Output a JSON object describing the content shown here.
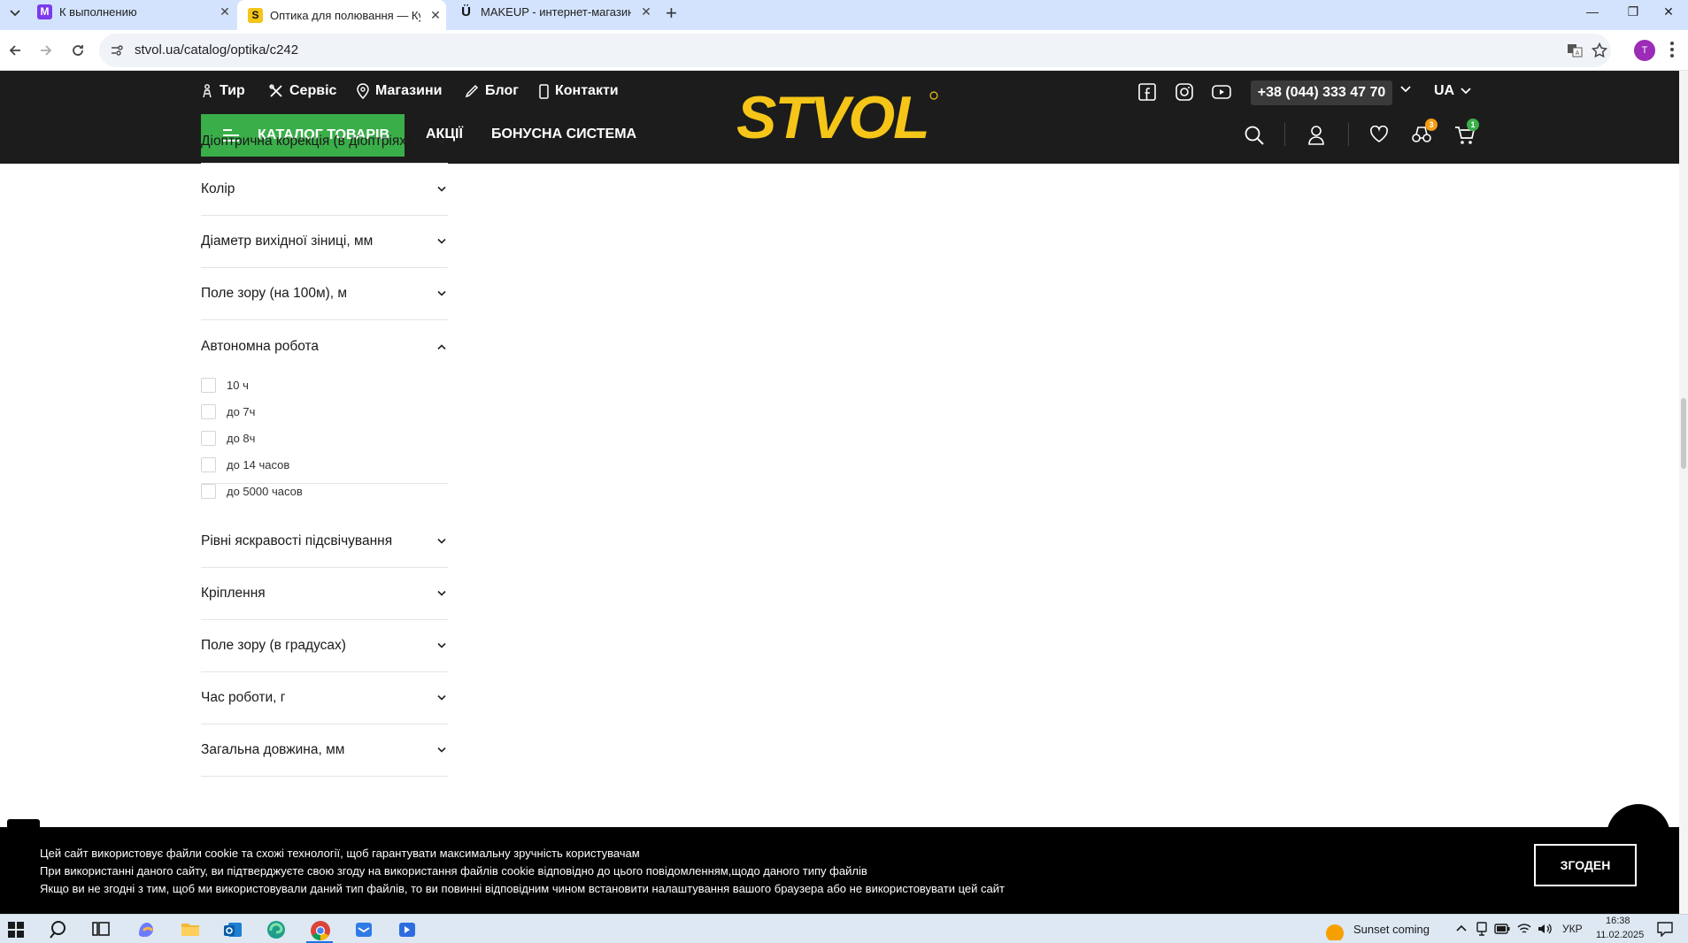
{
  "browser": {
    "tabs": [
      {
        "title": "К выполнению",
        "favicon": "M",
        "favicon_color": "#7c3aed",
        "active": false
      },
      {
        "title": "Оптика для полювання — Куп",
        "favicon": "S",
        "favicon_color": "#111111",
        "active": true
      },
      {
        "title": "MAKEUP - интернет-магазин к",
        "favicon": "Ü",
        "favicon_color": "#111111",
        "active": false
      }
    ],
    "url": "stvol.ua/catalog/optika/c242",
    "profile_initial": "T"
  },
  "header": {
    "top_links": [
      "Тир",
      "Сервіс",
      "Магазини",
      "Блог",
      "Контакти"
    ],
    "phone": "+38 (044) 333 47 70",
    "lang": "UA",
    "catalog_button": "КАТАЛОГ ТОВАРІВ",
    "nav_links": [
      "АКЦІЇ",
      "БОНУСНА СИСТЕМА"
    ],
    "logo_text": "STVOL",
    "compare_count": "3",
    "cart_count": "1",
    "accent": "#f5c518",
    "green": "#3aae49"
  },
  "filters": {
    "partial_label": "Діоптрична корекція (в діоптріях)",
    "collapsed_top": [
      "Колір",
      "Діаметр вихідної зіниці, мм",
      "Поле зору (на 100м), м"
    ],
    "expanded": {
      "label": "Автономна робота",
      "options": [
        "10 ч",
        "до 7ч",
        "до 8ч",
        "до 14 часов",
        "до 5000 часов"
      ]
    },
    "collapsed_bottom": [
      "Рівні яскравості підсвічування",
      "Кріплення",
      "Поле зору (в градусах)",
      "Час роботи, г",
      "Загальна довжина, мм"
    ]
  },
  "cookie": {
    "line1": "Цей сайт використовує файли cookie та схожі технології, щоб гарантувати максимальну зручність користувачам",
    "line2": "При використанні даного сайту, ви підтверджуєте свою згоду на використання файлів cookie відповідно до цього повідомленням,щодо даного типу файлів",
    "line3": "Якщо ви не згодні з тим, щоб ми використовували даний тип файлів, то ви повинні відповідним чином встановити налаштування вашого браузера або не використовувати цей сайт",
    "button": "ЗГОДЕН"
  },
  "taskbar": {
    "weather": "Sunset coming",
    "lang": "УКР",
    "time": "16:38",
    "date": "11.02.2025"
  }
}
